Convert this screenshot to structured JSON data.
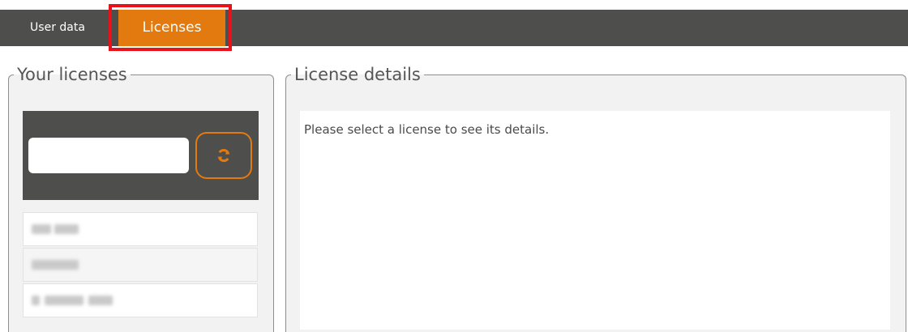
{
  "tabs": [
    {
      "label": "User data",
      "active": false
    },
    {
      "label": "Licenses",
      "active": true
    }
  ],
  "colors": {
    "accent": "#e37a0f",
    "bar": "#4e4e4c",
    "highlight": "#e8121b"
  },
  "your_licenses": {
    "legend": "Your licenses",
    "search": {
      "value": "",
      "placeholder": ""
    },
    "refresh_icon": "refresh-icon",
    "items": [
      {
        "label": "",
        "redacted": true
      },
      {
        "label": "",
        "redacted": true
      },
      {
        "label": "",
        "redacted": true
      }
    ]
  },
  "license_details": {
    "legend": "License details",
    "message": "Please select a license to see its details."
  }
}
